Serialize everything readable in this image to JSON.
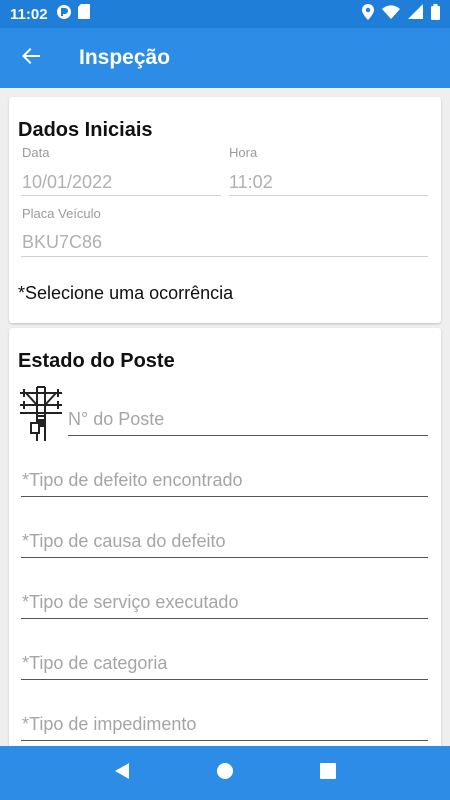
{
  "status_bar": {
    "time": "11:02",
    "icons": [
      "app-notification-icon",
      "sd-card-icon",
      "location-icon",
      "wifi-icon",
      "signal-icon",
      "battery-icon"
    ]
  },
  "app_bar": {
    "back_icon": "arrow-back-icon",
    "title": "Inspeção"
  },
  "dados_iniciais": {
    "title": "Dados Iniciais",
    "data_label": "Data",
    "data_value": "10/01/2022",
    "hora_label": "Hora",
    "hora_value": "11:02",
    "placa_label": "Placa Veículo",
    "placa_value": "BKU7C86",
    "ocorrencia_text": "*Selecione uma ocorrência"
  },
  "estado_poste": {
    "title": "Estado do Poste",
    "pole_icon": "utility-pole-icon",
    "numero_poste_hint": "N° do Poste",
    "defeito_hint": "*Tipo de defeito encontrado",
    "causa_hint": "*Tipo de causa do defeito",
    "servico_hint": "*Tipo de serviço executado",
    "categoria_hint": "*Tipo de categoria",
    "impedimento_hint": "*Tipo de impedimento"
  },
  "nav_bar": {
    "icons": [
      "nav-back-icon",
      "nav-home-icon",
      "nav-recents-icon"
    ]
  },
  "colors": {
    "status_bar": "#1f7fd8",
    "app_bar": "#2d8de6",
    "background": "#efefef"
  }
}
